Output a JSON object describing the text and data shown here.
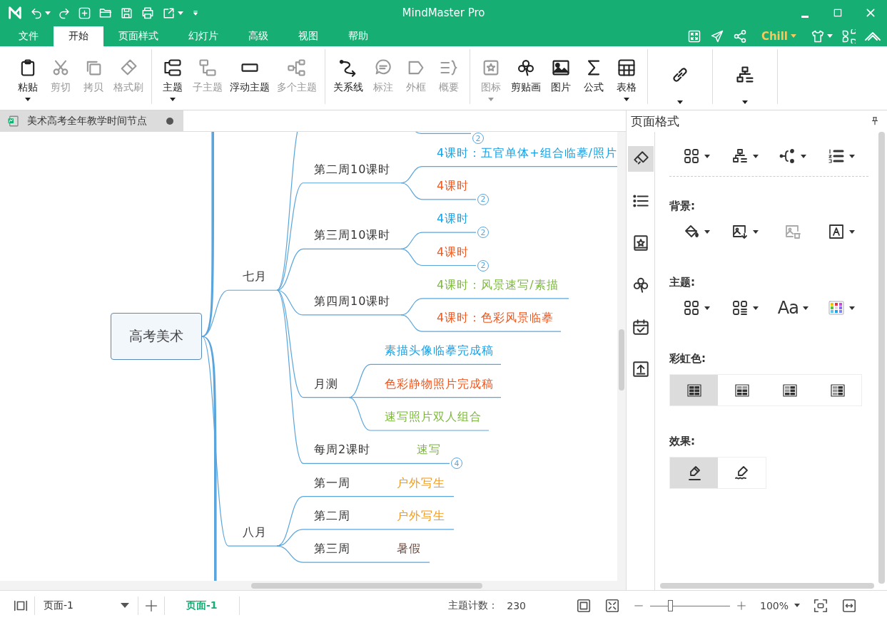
{
  "window": {
    "title": "MindMaster Pro"
  },
  "menu_tabs": [
    {
      "label": "文件",
      "selected": false
    },
    {
      "label": "开始",
      "selected": true
    },
    {
      "label": "页面样式",
      "selected": false
    },
    {
      "label": "幻灯片",
      "selected": false
    },
    {
      "label": "高级",
      "selected": false
    },
    {
      "label": "视图",
      "selected": false
    },
    {
      "label": "帮助",
      "selected": false
    }
  ],
  "theme_switch": "Chill",
  "toolbar": [
    [
      {
        "label": "粘贴",
        "disabled": false,
        "dropdown": true
      },
      {
        "label": "剪切",
        "disabled": true,
        "dropdown": false
      },
      {
        "label": "拷贝",
        "disabled": true,
        "dropdown": false
      },
      {
        "label": "格式刷",
        "disabled": true,
        "dropdown": false
      }
    ],
    [
      {
        "label": "主题",
        "disabled": false,
        "dropdown": true
      },
      {
        "label": "子主题",
        "disabled": true,
        "dropdown": false
      },
      {
        "label": "浮动主题",
        "disabled": false,
        "dropdown": false
      },
      {
        "label": "多个主题",
        "disabled": true,
        "dropdown": false
      }
    ],
    [
      {
        "label": "关系线",
        "disabled": false,
        "dropdown": false
      },
      {
        "label": "标注",
        "disabled": true,
        "dropdown": false
      },
      {
        "label": "外框",
        "disabled": true,
        "dropdown": false
      },
      {
        "label": "概要",
        "disabled": true,
        "dropdown": false
      }
    ],
    [
      {
        "label": "图标",
        "disabled": true,
        "dropdown": true
      },
      {
        "label": "剪贴画",
        "disabled": false,
        "dropdown": false
      },
      {
        "label": "图片",
        "disabled": false,
        "dropdown": false
      },
      {
        "label": "公式",
        "disabled": false,
        "dropdown": false
      },
      {
        "label": "表格",
        "disabled": false,
        "dropdown": true
      }
    ],
    [
      {
        "disabled": false,
        "dropdown": true
      }
    ],
    [
      {
        "disabled": false,
        "dropdown": true
      }
    ]
  ],
  "document_tab": {
    "title": "美术高考全年教学时间节点",
    "modified": true
  },
  "map": {
    "root": {
      "text": "高考美术",
      "children": [
        {
          "text": "七月",
          "children": [
            {
              "children": [
                {
                  "badge": "2"
                }
              ]
            },
            {
              "text": "第二周10课时",
              "children": [
                {
                  "text": "4课时：五官单体+组合临摹/照片",
                  "color": "#16a0e6"
                },
                {
                  "text": "4课时",
                  "color": "#f0561d",
                  "badge": "2"
                }
              ]
            },
            {
              "text": "第三周10课时",
              "children": [
                {
                  "text": "4课时",
                  "color": "#16a0e6",
                  "badge": "2"
                },
                {
                  "text": "4课时",
                  "color": "#f0561d",
                  "badge": "2"
                }
              ]
            },
            {
              "text": "第四周10课时",
              "children": [
                {
                  "text": "4课时：风景速写/素描",
                  "color": "#7cb83d"
                },
                {
                  "text": "4课时：色彩风景临摹",
                  "color": "#f0561d"
                }
              ]
            },
            {
              "text": "月测",
              "children": [
                {
                  "text": "素描头像临摹完成稿",
                  "color": "#16a0e6"
                },
                {
                  "text": "色彩静物照片完成稿",
                  "color": "#f0561d"
                },
                {
                  "text": "速写照片双人组合",
                  "color": "#7cb83d"
                }
              ]
            },
            {
              "text": "每周2课时",
              "children": [
                {
                  "text": "速写",
                  "color": "#7cb83d",
                  "badge": "4"
                }
              ]
            }
          ]
        },
        {
          "text": "八月",
          "children": [
            {
              "text": "第一周",
              "children": [
                {
                  "text": "户外写生",
                  "color": "#f39a1a"
                }
              ]
            },
            {
              "text": "第二周",
              "children": [
                {
                  "text": "户外写生",
                  "color": "#f39a1a"
                }
              ]
            },
            {
              "text": "第三周",
              "children": [
                {
                  "text": "暑假",
                  "color": "#6b4b3e"
                }
              ]
            }
          ]
        }
      ]
    }
  },
  "format_panel": {
    "title": "页面格式",
    "side_tabs": [
      {
        "selected": true
      },
      {
        "selected": false
      },
      {
        "selected": false
      },
      {
        "selected": false
      },
      {
        "selected": false
      },
      {
        "selected": false
      }
    ],
    "layout_tools": [
      {
        "dropdown": true
      },
      {
        "dropdown": true
      },
      {
        "dropdown": true
      },
      {
        "dropdown": true
      }
    ],
    "sections": [
      {
        "kind": "tools",
        "label": "背景:",
        "tools": [
          {
            "disabled": false,
            "dropdown": true
          },
          {
            "disabled": false,
            "dropdown": true
          },
          {
            "disabled": true,
            "dropdown": false
          },
          {
            "disabled": false,
            "dropdown": true
          }
        ]
      },
      {
        "kind": "tools",
        "label": "主题:",
        "tools": [
          {
            "disabled": false,
            "dropdown": true
          },
          {
            "disabled": false,
            "dropdown": true
          },
          {
            "disabled": false,
            "dropdown": true,
            "text": "Aa"
          },
          {
            "disabled": false,
            "dropdown": true
          }
        ]
      },
      {
        "kind": "options",
        "label": "彩虹色:",
        "options": [
          {
            "selected": true
          },
          {
            "selected": false
          },
          {
            "selected": false
          },
          {
            "selected": false
          }
        ]
      },
      {
        "kind": "options",
        "label": "效果:",
        "options": [
          {
            "selected": true
          },
          {
            "selected": false
          }
        ]
      }
    ]
  },
  "status_bar": {
    "page_select": "页面-1",
    "pages": [
      {
        "label": "页面-1",
        "selected": true
      }
    ],
    "topic_count_label": "主题计数：",
    "topic_count": "230",
    "zoom": {
      "level": 0.25,
      "reading": "100%"
    }
  }
}
